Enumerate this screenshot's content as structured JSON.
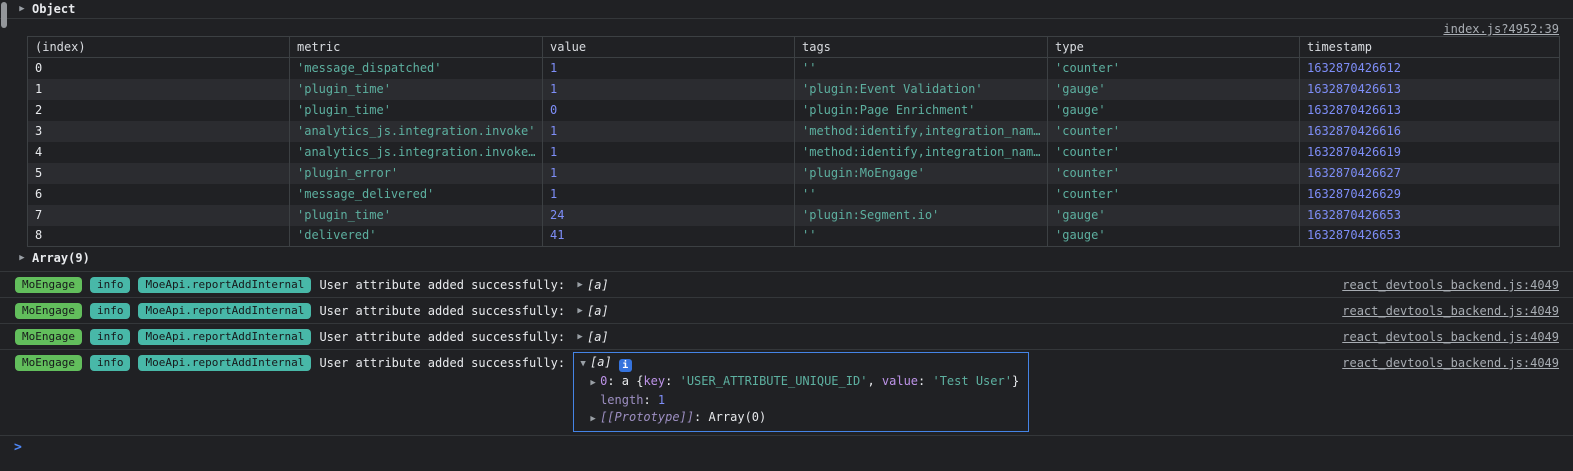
{
  "colors": {
    "bg": "#202124",
    "row_alt": "#2b2c30",
    "border": "#3c4043",
    "entry_border": "#34373a",
    "text": "#e8eaed",
    "muted": "#9aa0a6",
    "string": "#5db0a0",
    "number": "#7e8ef8",
    "link": "#a8adb3",
    "badge_text": "#17191b",
    "badge_green": "#62be5c",
    "badge_teal": "#48b8a8",
    "key": "#bd93e8",
    "key_dim": "#9d8fc2",
    "prompt": "#4e87f6",
    "focus": "#4584e6",
    "info_icon_bg": "#3573dd"
  },
  "icons": {
    "expand": "▶",
    "collapse": "▼",
    "prompt": ">",
    "info": "i"
  },
  "object_entry": {
    "label": "Object"
  },
  "table_entry": {
    "source": "index.js?4952:39",
    "columns": [
      "(index)",
      "metric",
      "value",
      "tags",
      "type",
      "timestamp"
    ],
    "rows": [
      {
        "idx": "0",
        "metric": "'message_dispatched'",
        "value": "1",
        "tags": "''",
        "type": "'counter'",
        "ts": "1632870426612"
      },
      {
        "idx": "1",
        "metric": "'plugin_time'",
        "value": "1",
        "tags": "'plugin:Event Validation'",
        "type": "'gauge'",
        "ts": "1632870426613"
      },
      {
        "idx": "2",
        "metric": "'plugin_time'",
        "value": "0",
        "tags": "'plugin:Page Enrichment'",
        "type": "'gauge'",
        "ts": "1632870426613"
      },
      {
        "idx": "3",
        "metric": "'analytics_js.integration.invoke'",
        "value": "1",
        "tags": "'method:identify,integration_nam…",
        "type": "'counter'",
        "ts": "1632870426616"
      },
      {
        "idx": "4",
        "metric": "'analytics_js.integration.invoke…",
        "value": "1",
        "tags": "'method:identify,integration_nam…",
        "type": "'counter'",
        "ts": "1632870426619"
      },
      {
        "idx": "5",
        "metric": "'plugin_error'",
        "value": "1",
        "tags": "'plugin:MoEngage'",
        "type": "'counter'",
        "ts": "1632870426627"
      },
      {
        "idx": "6",
        "metric": "'message_delivered'",
        "value": "1",
        "tags": "''",
        "type": "'counter'",
        "ts": "1632870426629"
      },
      {
        "idx": "7",
        "metric": "'plugin_time'",
        "value": "24",
        "tags": "'plugin:Segment.io'",
        "type": "'gauge'",
        "ts": "1632870426653"
      },
      {
        "idx": "8",
        "metric": "'delivered'",
        "value": "41",
        "tags": "''",
        "type": "'gauge'",
        "ts": "1632870426653"
      }
    ]
  },
  "array_entry": {
    "label": "Array(9)"
  },
  "logs": [
    {
      "badges": [
        "MoEngage",
        "info",
        "MoeApi.reportAddInternal"
      ],
      "message": "User attribute added successfully:",
      "preview": "[a]",
      "source": "react_devtools_backend.js:4049"
    },
    {
      "badges": [
        "MoEngage",
        "info",
        "MoeApi.reportAddInternal"
      ],
      "message": "User attribute added successfully:",
      "preview": "[a]",
      "source": "react_devtools_backend.js:4049"
    },
    {
      "badges": [
        "MoEngage",
        "info",
        "MoeApi.reportAddInternal"
      ],
      "message": "User attribute added successfully:",
      "preview": "[a]",
      "source": "react_devtools_backend.js:4049"
    },
    {
      "badges": [
        "MoEngage",
        "info",
        "MoeApi.reportAddInternal"
      ],
      "message": "User attribute added successfully:",
      "preview": "[a]",
      "source": "react_devtools_backend.js:4049"
    }
  ],
  "expanded_tree": {
    "root_preview": "[a]",
    "sep": ": ",
    "item_tokens": [
      {
        "c": "key",
        "s": "0"
      },
      {
        "c": "plain",
        "s": ": "
      },
      {
        "c": "plain",
        "s": "a "
      },
      {
        "c": "plain",
        "s": "{"
      },
      {
        "c": "key",
        "s": "key"
      },
      {
        "c": "plain",
        "s": ": "
      },
      {
        "c": "string",
        "s": "'USER_ATTRIBUTE_UNIQUE_ID'"
      },
      {
        "c": "plain",
        "s": ", "
      },
      {
        "c": "key",
        "s": "value"
      },
      {
        "c": "plain",
        "s": ": "
      },
      {
        "c": "string",
        "s": "'Test User'"
      },
      {
        "c": "plain",
        "s": "}"
      }
    ],
    "length_key": "length",
    "length_value": "1",
    "proto_key": "[[Prototype]]",
    "proto_value": "Array(0)"
  }
}
